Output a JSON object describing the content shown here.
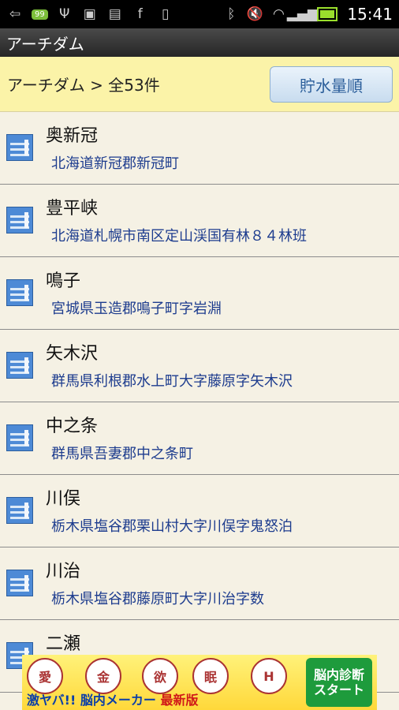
{
  "status_bar": {
    "badge": "99",
    "time": "15:41"
  },
  "app": {
    "title": "アーチダム"
  },
  "header": {
    "breadcrumb": "アーチダム > 全53件",
    "sort_button": "貯水量順"
  },
  "dams": [
    {
      "name": "奥新冠",
      "address": "北海道新冠郡新冠町"
    },
    {
      "name": "豊平峡",
      "address": "北海道札幌市南区定山渓国有林８４林班"
    },
    {
      "name": "鳴子",
      "address": "宮城県玉造郡鳴子町字岩淵"
    },
    {
      "name": "矢木沢",
      "address": "群馬県利根郡水上町大字藤原字矢木沢"
    },
    {
      "name": "中之条",
      "address": "群馬県吾妻郡中之条町"
    },
    {
      "name": "川俣",
      "address": "栃木県塩谷郡栗山村大字川俣字鬼怒泊"
    },
    {
      "name": "川治",
      "address": "栃木県塩谷郡藤原町大字川治字数"
    },
    {
      "name": "二瀬",
      "address": ""
    }
  ],
  "ad": {
    "bubbles": [
      "愛",
      "金",
      "欲",
      "眠",
      "H"
    ],
    "tagline_a": "激ヤバ!! 脳内メーカー",
    "tagline_b": "最新版",
    "start_line1": "脳内診断",
    "start_line2": "スタート"
  }
}
